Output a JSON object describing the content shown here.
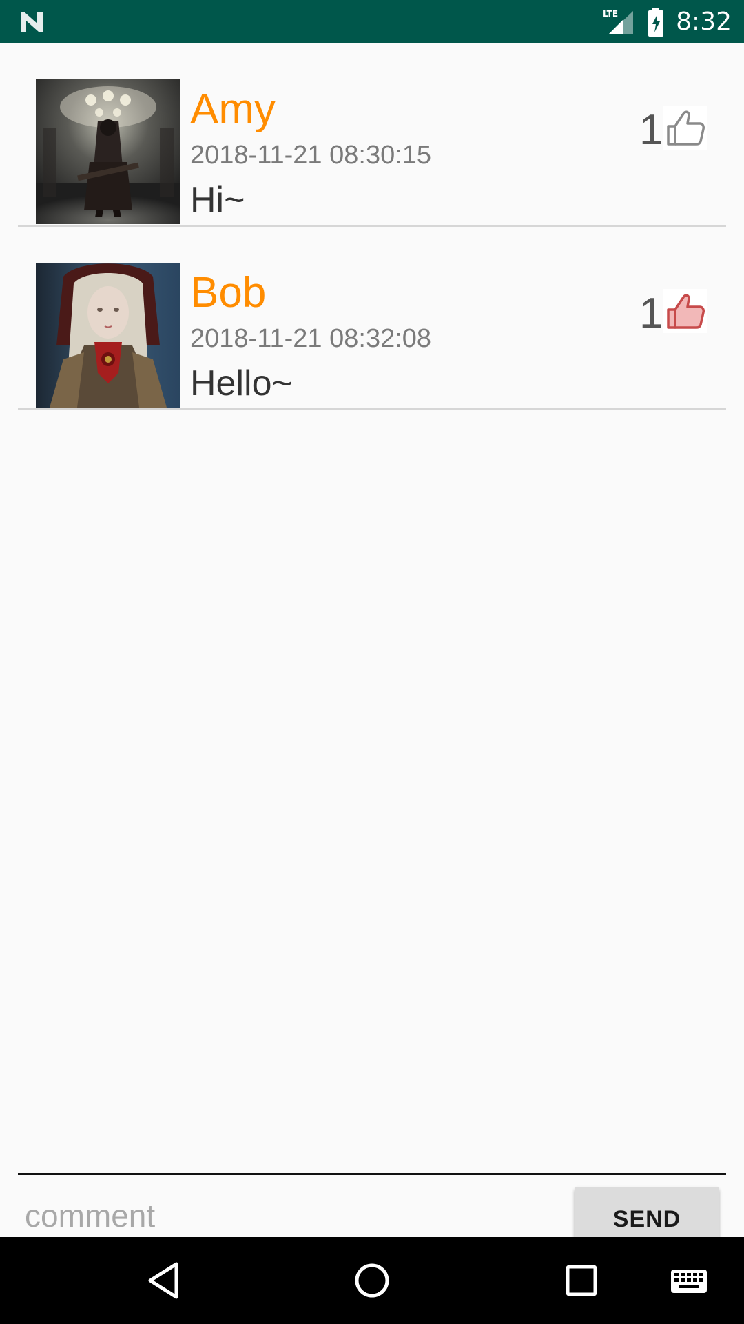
{
  "status_bar": {
    "network": "LTE",
    "time": "8:32",
    "icons": [
      "android-n-icon",
      "lte-signal-icon",
      "battery-charging-icon"
    ]
  },
  "comments": [
    {
      "username": "Amy",
      "timestamp": "2018-11-21 08:30:15",
      "message": "Hi~",
      "likes": "1",
      "liked": false,
      "avatar": "avatar-dark-knight-image"
    },
    {
      "username": "Bob",
      "timestamp": "2018-11-21 08:32:08",
      "message": "Hello~",
      "likes": "1",
      "liked": true,
      "avatar": "avatar-doll-lady-image"
    }
  ],
  "composer": {
    "placeholder": "comment",
    "value": "",
    "send_label": "SEND"
  },
  "colors": {
    "status_bar": "#00574b",
    "username": "#ff8c00",
    "input_accent": "#d81b60",
    "liked_icon": "#c74a4a"
  },
  "nav_bar": {
    "icons": [
      "back-icon",
      "home-icon",
      "recents-icon",
      "keyboard-icon"
    ]
  }
}
